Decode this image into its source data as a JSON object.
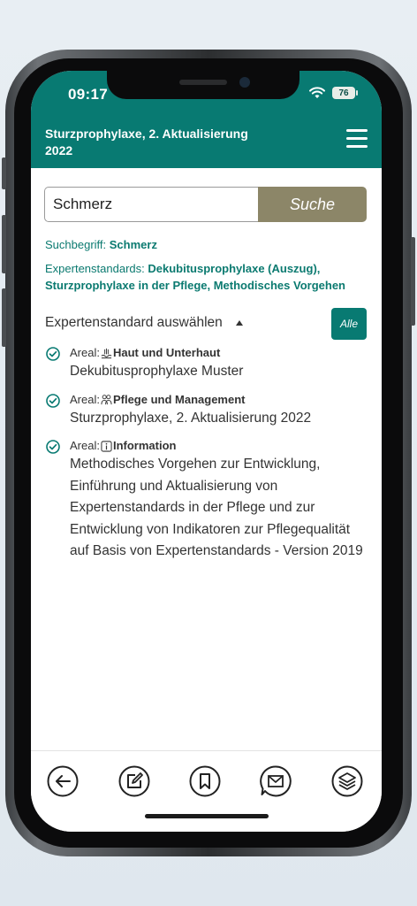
{
  "status_bar": {
    "time": "09:17",
    "battery": "76"
  },
  "header": {
    "title": "Sturzprophylaxe, 2. Aktualisierung 2022"
  },
  "search": {
    "value": "Schmerz",
    "button_label": "Suche"
  },
  "summary": {
    "term_label": "Suchbegriff:",
    "term_value": "Schmerz",
    "standards_label": "Expertenstandards:",
    "standards_value": "Dekubitusprophylaxe (Auszug), Sturzprophylaxe in der Pflege, Methodisches Vorgehen"
  },
  "selector": {
    "label": "Expertenstandard auswählen",
    "all_button": "Alle"
  },
  "results": [
    {
      "areal_label": "Areal:",
      "areal_icon": "skin-icon",
      "areal_name": "Haut und Unterhaut",
      "title": "Dekubitusprophylaxe Muster"
    },
    {
      "areal_label": "Areal:",
      "areal_icon": "people-icon",
      "areal_name": "Pflege und Management",
      "title": "Sturzprophylaxe, 2. Aktualisierung 2022"
    },
    {
      "areal_label": "Areal:",
      "areal_icon": "info-icon",
      "areal_name": "Information",
      "title": "Methodisches Vorgehen zur Entwicklung, Einführung und Aktualisierung von Expertenstandards in der Pflege und zur Entwicklung von Indikatoren zur Pflegequalität auf Basis von Expertenstandards - Version 2019"
    }
  ],
  "bottom_nav": [
    "back-icon",
    "edit-icon",
    "bookmark-icon",
    "message-icon",
    "layers-icon"
  ],
  "colors": {
    "primary": "#087a72",
    "search_button": "#8c8668",
    "text": "#333333"
  }
}
